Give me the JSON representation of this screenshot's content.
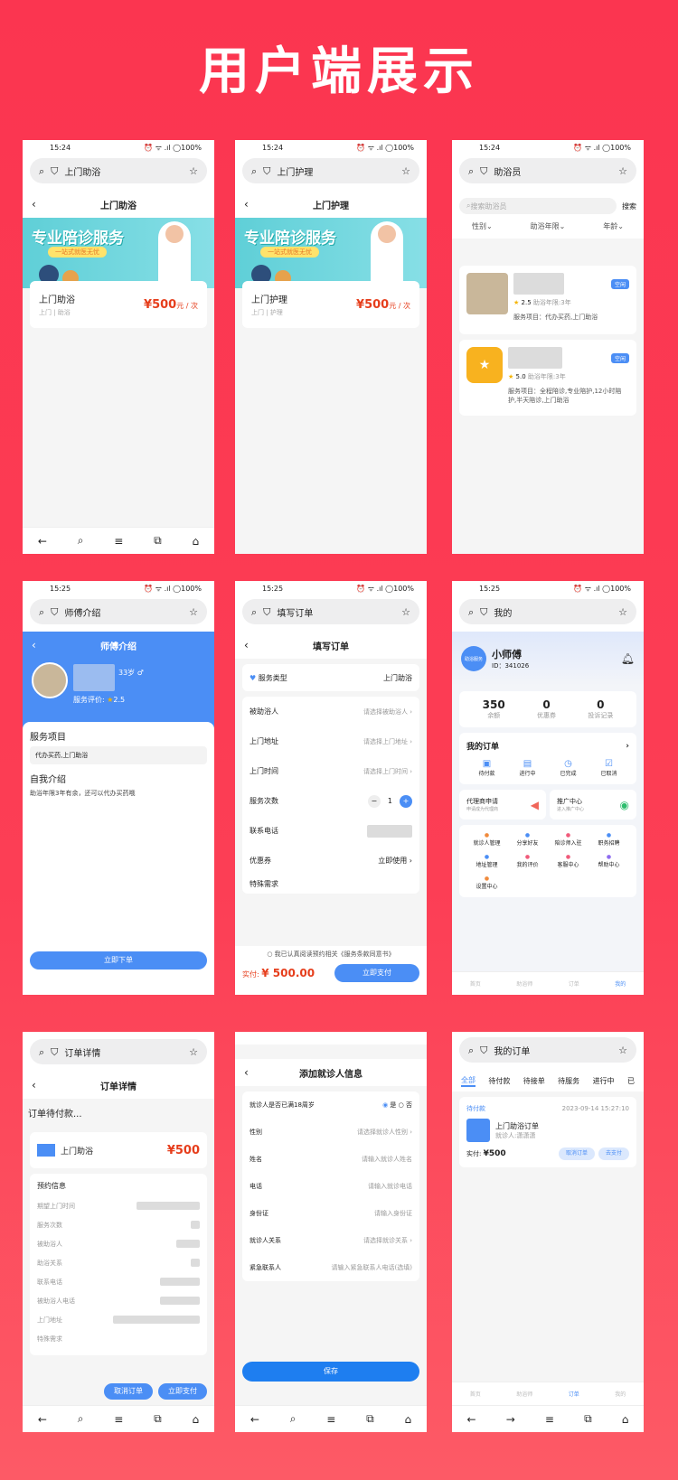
{
  "headline": "用户端展示",
  "colors": {
    "bg": "#fb3550",
    "accent": "#4b8ef5",
    "price": "#e63e1c"
  },
  "icons": {
    "search": "search-icon",
    "shield": "shield-icon",
    "star": "star-icon"
  },
  "s1": {
    "time": "15:24",
    "status": "⏰ ᯤ .ıl ◯100%",
    "url": "上门助浴",
    "title": "上门助浴",
    "banner": "专业陪诊服务",
    "banner_sub": "一站式就医无忧",
    "svc_name": "上门助浴",
    "svc_sub": "上门 | 助浴",
    "price": "¥500",
    "unit": "元 / 次"
  },
  "s2": {
    "time": "15:24",
    "status": "⏰ ᯤ .ıl ◯100%",
    "url": "上门护理",
    "title": "上门护理",
    "banner": "专业陪诊服务",
    "banner_sub": "一站式就医无忧",
    "svc_name": "上门护理",
    "svc_sub": "上门 | 护理",
    "price": "¥500",
    "unit": "元 / 次"
  },
  "s3": {
    "time": "15:24",
    "status": "⏰ ᯤ .ıl ◯100%",
    "url": "助浴员",
    "search_ph": "搜索助浴员",
    "search_btn": "搜索",
    "filters": [
      "性别",
      "助浴年限",
      "年龄"
    ],
    "workers": [
      {
        "badge": "空闲",
        "rating": "2.5",
        "years": "助浴年限:3年",
        "items": "服务项目：代办买药,上门助浴"
      },
      {
        "badge": "空闲",
        "rating": "5.0",
        "years": "助浴年限:3年",
        "items": "服务项目：全程陪诊,专业陪护,12小时陪护,半天陪诊,上门助浴"
      }
    ]
  },
  "s4": {
    "time": "15:25",
    "status": "⏰ ᯤ .ıl ◯100%",
    "url": "师傅介绍",
    "title": "师傅介绍",
    "age": "33岁",
    "gender": "♂",
    "rating_label": "服务评价:",
    "rating": "2.5",
    "svc_title": "服务项目",
    "svc_list": "代办买药,上门助浴",
    "intro_title": "自我介绍",
    "intro": "助浴年限3年有余，还可以代办买药哦",
    "order_btn": "立即下单"
  },
  "s5": {
    "time": "15:25",
    "status": "⏰ ᯤ .ıl ◯100%",
    "url": "填写订单",
    "title": "填写订单",
    "service_type_label": "服务类型",
    "service_type": "上门助浴",
    "fields": [
      {
        "label": "被助浴人",
        "value": "请选择被助浴人"
      },
      {
        "label": "上门地址",
        "value": "请选择上门地址"
      },
      {
        "label": "上门时间",
        "value": "请选择上门时间"
      }
    ],
    "times_label": "服务次数",
    "times": "1",
    "phone_label": "联系电话",
    "coupon_label": "优惠券",
    "coupon": "立即使用",
    "req_label": "特殊需求",
    "agree": "我已认真阅读预约相关《服务条款同意书》",
    "pay_label": "实付:",
    "pay_amount": "¥ 500.00",
    "pay_btn": "立即支付"
  },
  "s6": {
    "time": "15:25",
    "status": "⏰ ᯤ .ıl ◯100%",
    "url": "我的",
    "avatar_text": "助浴服务",
    "name": "小师傅",
    "id": "ID：341026",
    "stats": [
      {
        "value": "350",
        "label": "余额"
      },
      {
        "value": "0",
        "label": "优惠券"
      },
      {
        "value": "0",
        "label": "投诉记录"
      }
    ],
    "orders_title": "我的订单",
    "orders": [
      "待付款",
      "进行中",
      "已完成",
      "已取消"
    ],
    "agent": {
      "title": "代理商申请",
      "sub": "申请成为代理商"
    },
    "promo": {
      "title": "推广中心",
      "sub": "进入推广中心"
    },
    "tools": [
      "就诊人管理",
      "分享好友",
      "陪诊师入驻",
      "职务招聘",
      "地址管理",
      "我的评价",
      "客服中心",
      "帮助中心",
      "设置中心"
    ],
    "tabs": [
      "首页",
      "助浴师",
      "订单",
      "我的"
    ]
  },
  "s7": {
    "url": "订单详情",
    "title": "订单详情",
    "state": "订单待付款...",
    "svc": "上门助浴",
    "price": "¥500",
    "info_title": "预约信息",
    "info": [
      "期望上门时间",
      "服务次数",
      "被助浴人",
      "助浴关系",
      "联系电话",
      "被助浴人电话",
      "上门地址",
      "特殊需求"
    ],
    "cancel": "取消订单",
    "pay": "立即支付"
  },
  "s8": {
    "title": "添加就诊人信息",
    "adult_label": "就诊人是否已满18周岁",
    "yes": "是",
    "no": "否",
    "fields": [
      {
        "label": "性别",
        "ph": "请选择就诊人性别"
      },
      {
        "label": "姓名",
        "ph": "请输入就诊人姓名"
      },
      {
        "label": "电话",
        "ph": "请输入就诊电话"
      },
      {
        "label": "身份证",
        "ph": "请输入身份证"
      },
      {
        "label": "就诊人关系",
        "ph": "请选择就诊关系"
      },
      {
        "label": "紧急联系人",
        "ph": "请输入紧急联系人电话(选填)"
      }
    ],
    "save": "保存"
  },
  "s9": {
    "url": "我的订单",
    "tabs": [
      "全部",
      "待付款",
      "待接单",
      "待服务",
      "进行中",
      "已"
    ],
    "status": "待付款",
    "date": "2023-09-14 15:27:10",
    "svc": "上门助浴订单",
    "patient": "就诊人:潇潇潇",
    "pay_label": "实付:",
    "pay": "¥500",
    "cancel": "取消订单",
    "go_pay": "去支付",
    "bottom": [
      "首页",
      "助浴师",
      "订单",
      "我的"
    ]
  }
}
